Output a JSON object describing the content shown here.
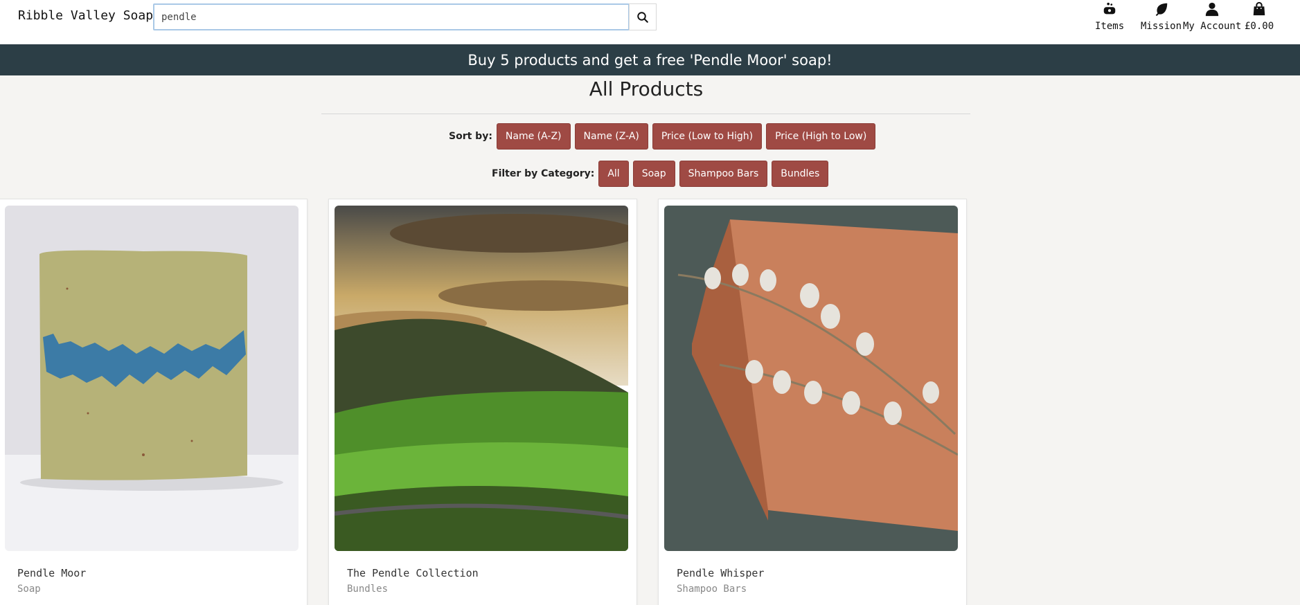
{
  "header": {
    "brand": "Ribble Valley Soap Co.",
    "search": {
      "value": "pendle",
      "placeholder": ""
    },
    "nav": [
      {
        "label": "Items",
        "icon": "soap-icon"
      },
      {
        "label": "Mission",
        "icon": "leaf-icon"
      },
      {
        "label": "My Account",
        "icon": "user-icon"
      },
      {
        "label": "£0.00",
        "icon": "shopping-bag-icon"
      }
    ]
  },
  "banner": {
    "text": "Buy 5 products and get a free 'Pendle Moor' soap!"
  },
  "main": {
    "title": "All Products",
    "sort": {
      "label": "Sort by:",
      "options": [
        "Name (A-Z)",
        "Name (Z-A)",
        "Price (Low to High)",
        "Price (High to Low)"
      ]
    },
    "filter": {
      "label": "Filter by Category:",
      "options": [
        "All",
        "Soap",
        "Shampoo Bars",
        "Bundles"
      ]
    },
    "products": [
      {
        "name": "Pendle Moor",
        "category": "Soap"
      },
      {
        "name": "The Pendle Collection",
        "category": "Bundles"
      },
      {
        "name": "Pendle Whisper",
        "category": "Shampoo Bars"
      }
    ]
  },
  "colors": {
    "banner_bg": "#2c3e46",
    "accent_button": "#9f4a44",
    "page_bg": "#f5f4f2"
  }
}
